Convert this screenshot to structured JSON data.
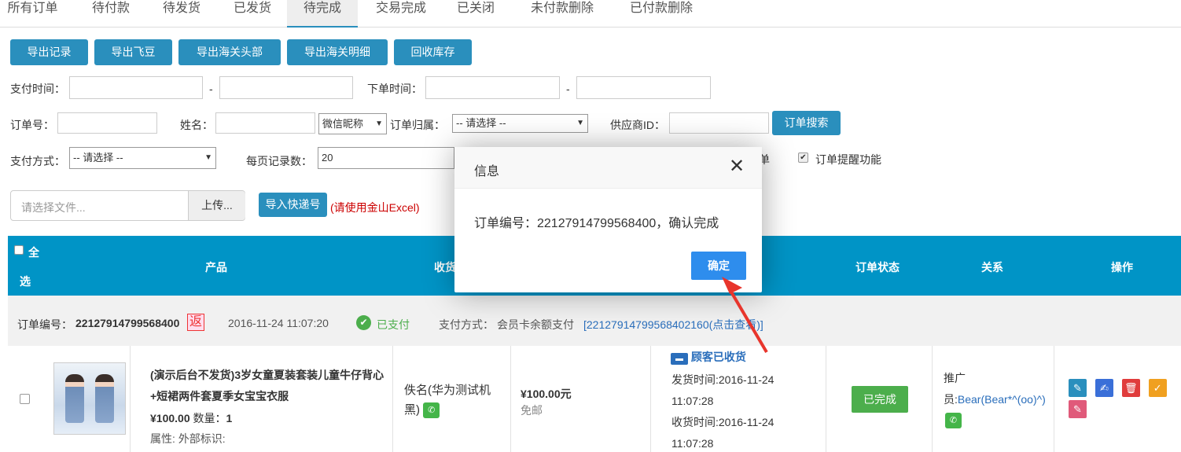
{
  "tabs": [
    "所有订单",
    "待付款",
    "待发货",
    "已发货",
    "待完成",
    "交易完成",
    "已关闭",
    "未付款删除",
    "已付款删除"
  ],
  "toolbar": {
    "export_records": "导出记录",
    "export_feidou": "导出飞豆",
    "export_customs_head": "导出海关头部",
    "export_customs_detail": "导出海关明细",
    "recycle_stock": "回收库存"
  },
  "filters": {
    "pay_time_label": "支付时间：",
    "dash1": "-",
    "order_time_label": "下单时间：",
    "dash2": "-",
    "order_no_label": "订单号：",
    "name_label": "姓名：",
    "name_type_value": "微信昵称",
    "belong_label": "订单归属：",
    "belong_value": "-- 请选择 --",
    "supplier_label": "供应商ID：",
    "search_button": "订单搜索",
    "pay_method_label": "支付方式：",
    "pay_method_value": "-- 请选择 --",
    "per_page_label": "每页记录数：",
    "per_page_value": "20",
    "partial_text": "单",
    "reminder_label": "订单提醒功能"
  },
  "import": {
    "file_placeholder": "请选择文件...",
    "upload_button": "上传...",
    "import_button": "导入快递号",
    "hint": "(请使用金山Excel)"
  },
  "table_header": {
    "select_all_1": "全",
    "select_all_2": "选",
    "product": "产品",
    "receiver": "收货",
    "status": "订单状态",
    "relation": "关系",
    "actions": "操作"
  },
  "order": {
    "number_label": "订单编号：",
    "number": "22127914799568400",
    "return_badge": "返",
    "date": "2016-11-24 11:07:20",
    "paid": "已支付",
    "pay_method_label": "支付方式：",
    "pay_method": "会员卡余额支付",
    "pay_link": "[22127914799568402160(点击查看)]",
    "product_title": "(演示后台不发货)3岁女童夏装套装儿童牛仔背心+短裙两件套夏季女宝宝衣服",
    "product_price": "¥100.00",
    "qty_label": "数量：",
    "qty": "1",
    "attr": "属性: 外部标识:",
    "receiver": "佚名(华为测试机黑)",
    "amount": "¥100.00元",
    "shipping": "免邮",
    "ship_status": "顾客已收货",
    "ship_time": "发货时间:2016-11-24 11:07:28",
    "receive_time": "收货时间:2016-11-24 11:07:28",
    "status_button": "已完成",
    "relation_label": "推广员:",
    "relation_value": "Bear(Bear*^(oo)^)"
  },
  "modal": {
    "title": "信息",
    "message": "订单编号：22127914799568400，确认完成",
    "confirm": "确定"
  },
  "colors": {
    "primary": "#2a8fbd",
    "header": "#0094c6",
    "confirm": "#2e8ded",
    "success": "#4cae4c",
    "wechat": "#44b549",
    "arrow": "#e8352c"
  }
}
